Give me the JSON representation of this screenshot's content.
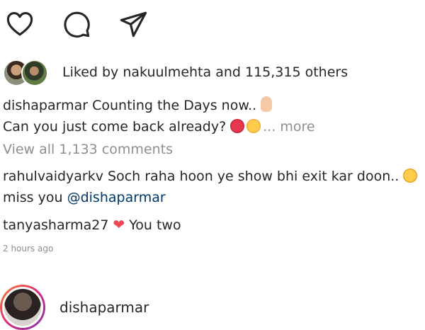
{
  "actions": {
    "like_icon": "heart-icon",
    "comment_icon": "comment-icon",
    "share_icon": "share-icon"
  },
  "likes": {
    "prefix": "Liked by",
    "user": "nakuulmehta",
    "connector": "and",
    "count_text": "115,315 others"
  },
  "caption": {
    "username": "dishaparmar",
    "line1": "Counting the Days now..",
    "line2": "Can you just come back already?",
    "more": "... more"
  },
  "view_all": "View all 1,133 comments",
  "comments": [
    {
      "username": "rahulvaidyarkv",
      "text": "Soch raha hoon ye show bhi exit kar doon..",
      "text_after": "miss you",
      "mention": "@dishaparmar"
    },
    {
      "username": "tanyasharma27",
      "text": "You two"
    }
  ],
  "timestamp": "2 hours ago",
  "profile": {
    "username": "dishaparmar"
  },
  "colors": {
    "text": "#262626",
    "muted": "#8e8e8e",
    "mention": "#00376b",
    "heart": "#ed4956"
  }
}
